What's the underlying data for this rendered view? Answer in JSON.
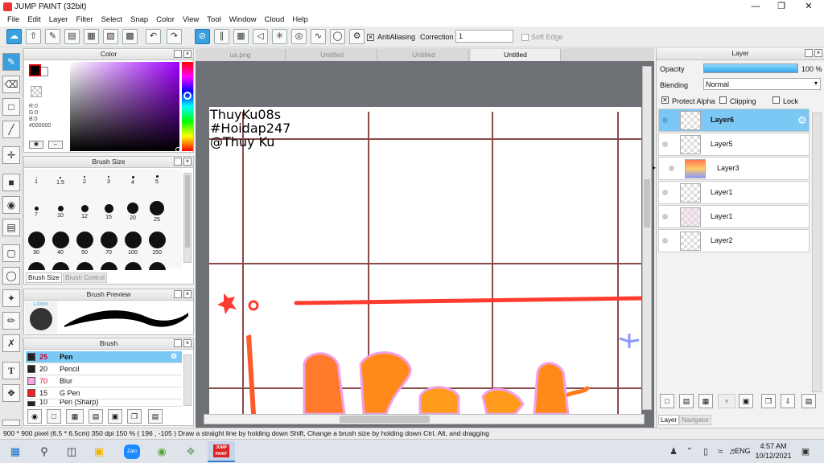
{
  "window": {
    "title": "JUMP PAINT (32bit)"
  },
  "menu": [
    "File",
    "Edit",
    "Layer",
    "Filter",
    "Select",
    "Snap",
    "Color",
    "View",
    "Tool",
    "Window",
    "Cloud",
    "Help"
  ],
  "toolbar": {
    "antialias_label": "AntiAliasing",
    "correction_label": "Correction",
    "correction_value": "1",
    "softedge_label": "Soft Edge"
  },
  "color_panel": {
    "title": "Color",
    "r": "R:0",
    "g": "G:0",
    "b": "B:0",
    "hex": "#000000"
  },
  "brush_size_panel": {
    "title": "Brush Size",
    "sizes": [
      "1",
      "1.5",
      "2",
      "3",
      "4",
      "5",
      "7",
      "10",
      "12",
      "15",
      "20",
      "25",
      "30",
      "40",
      "50",
      "70",
      "100",
      "150"
    ],
    "tab_size": "Brush Size",
    "tab_control": "Brush Control"
  },
  "brush_preview_panel": {
    "title": "Brush Preview",
    "size_label": "1.0mm"
  },
  "brush_panel": {
    "title": "Brush",
    "items": [
      {
        "size": "25",
        "name": "Pen",
        "color": "#222222"
      },
      {
        "size": "20",
        "name": "Pencil",
        "color": "#222222"
      },
      {
        "size": "70",
        "name": "Blur",
        "color": "#f7a8e0"
      },
      {
        "size": "15",
        "name": "G Pen",
        "color": "#ee2222"
      },
      {
        "size": "10",
        "name": "Pen (Sharp)",
        "color": "#222222"
      }
    ]
  },
  "canvas": {
    "tabs": [
      "ua.png",
      "Untitled",
      "Untitled",
      "Untitled"
    ],
    "active_tab": 3,
    "text_lines": [
      "ThuyKu08s",
      "#Hoidap247",
      "@Thuy Ku"
    ]
  },
  "layer_panel": {
    "title": "Layer",
    "opacity_label": "Opacity",
    "opacity_value": "100 %",
    "opacity": 1.0,
    "blending_label": "Blending",
    "blending_value": "Normal",
    "protect_alpha_label": "Protect Alpha",
    "clipping_label": "Clipping",
    "lock_label": "Lock",
    "layers": [
      "Layer6",
      "Layer5",
      "Layer3",
      "Layer1",
      "Layer1",
      "Layer2"
    ],
    "active_layer": 0,
    "tab_layer": "Layer",
    "tab_navigator": "Navigator"
  },
  "status": {
    "text": "900 * 900 pixel  (6.5 * 6.5cm)  350 dpi  150 %  ( 196 , -105 )  Draw a straight line by holding down Shift, Change a brush size by holding down Ctrl, Alt, and dragging"
  },
  "taskbar": {
    "lang": "ENG",
    "time": "4:57 AM",
    "date": "10/12/2021",
    "zalo": "Zalo",
    "app_label": "JUMP PAINT"
  },
  "colors": {
    "accent": "#3aa0e0",
    "grid": "#8b4a4a",
    "red_stroke": "#ff3b30"
  }
}
